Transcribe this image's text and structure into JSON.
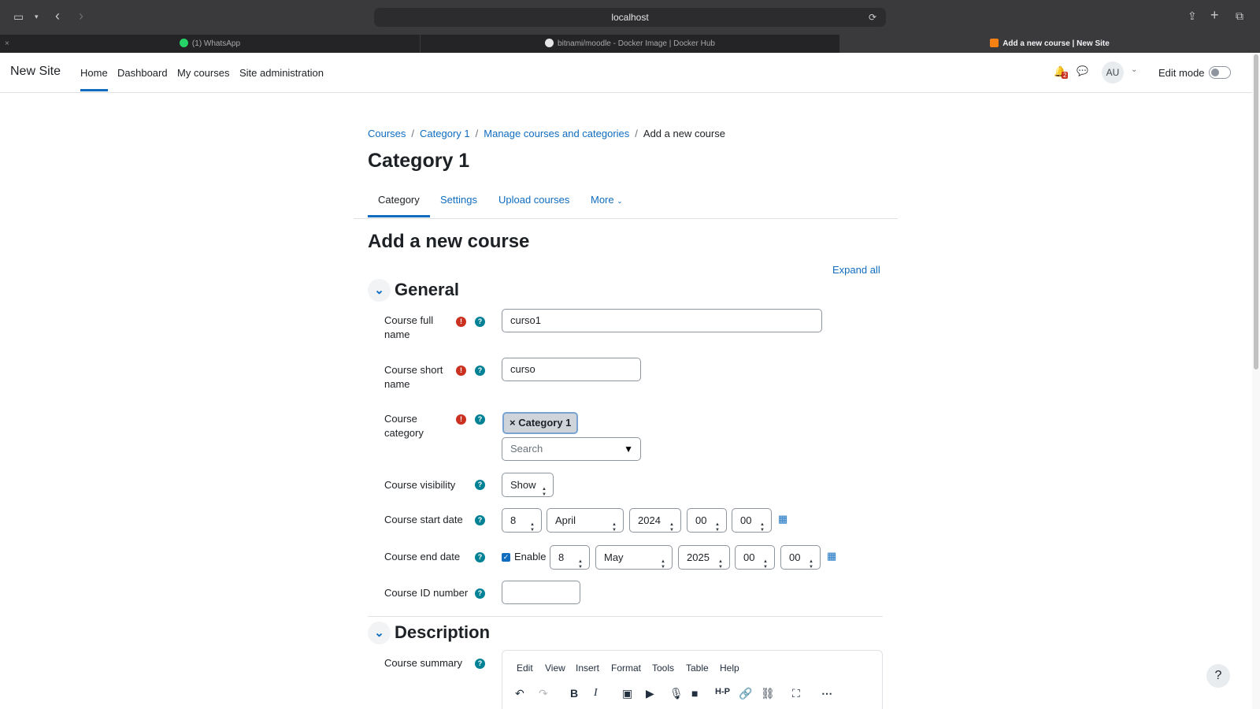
{
  "browser": {
    "url": "localhost",
    "tabs": [
      {
        "label": "(1) WhatsApp",
        "active": false
      },
      {
        "label": "bitnami/moodle - Docker Image | Docker Hub",
        "active": false
      },
      {
        "label": "Add a new course | New Site",
        "active": true
      }
    ]
  },
  "navbar": {
    "site_name": "New Site",
    "items": [
      "Home",
      "Dashboard",
      "My courses",
      "Site administration"
    ],
    "active_item": "Home",
    "notification_count": "2",
    "avatar_initials": "AU",
    "edit_mode_label": "Edit mode",
    "edit_mode_on": false
  },
  "breadcrumb": {
    "items": [
      "Courses",
      "Category 1",
      "Manage courses and categories"
    ],
    "current": "Add a new course"
  },
  "page": {
    "title": "Category 1",
    "heading": "Add a new course",
    "expand_all": "Expand all"
  },
  "secondary_nav": {
    "items": [
      "Category",
      "Settings",
      "Upload courses",
      "More"
    ],
    "active": "Category"
  },
  "general": {
    "title": "General",
    "full_name": {
      "label_line1": "Course full",
      "label_line2": "name",
      "value": "curso1"
    },
    "short_name": {
      "label_line1": "Course short",
      "label_line2": "name",
      "value": "curso"
    },
    "category": {
      "label_line1": "Course",
      "label_line2": "category",
      "selected": "Category 1",
      "search_placeholder": "Search"
    },
    "visibility": {
      "label": "Course visibility",
      "value": "Show"
    },
    "start_date": {
      "label": "Course start date",
      "day": "8",
      "month": "April",
      "year": "2024",
      "hour": "00",
      "minute": "00"
    },
    "end_date": {
      "label": "Course end date",
      "enable_label": "Enable",
      "enabled": true,
      "day": "8",
      "month": "May",
      "year": "2025",
      "hour": "00",
      "minute": "00"
    },
    "id_number": {
      "label": "Course ID number",
      "value": ""
    }
  },
  "description": {
    "title": "Description",
    "summary_label": "Course summary",
    "editor_menu": [
      "Edit",
      "View",
      "Insert",
      "Format",
      "Tools",
      "Table",
      "Help"
    ]
  },
  "icons": {
    "required": "exclamation-circle-icon",
    "help": "question-circle-icon",
    "calendar": "calendar-icon",
    "toolbar": [
      "undo-icon",
      "redo-icon",
      "bold-icon",
      "italic-icon",
      "image-icon",
      "media-icon",
      "microphone-icon",
      "video-icon",
      "h5p-icon",
      "link-icon",
      "unlink-icon",
      "fullscreen-icon",
      "more-icon"
    ]
  },
  "colors": {
    "accent": "#0f6cbf",
    "required": "#ca3120",
    "help": "#008196"
  }
}
